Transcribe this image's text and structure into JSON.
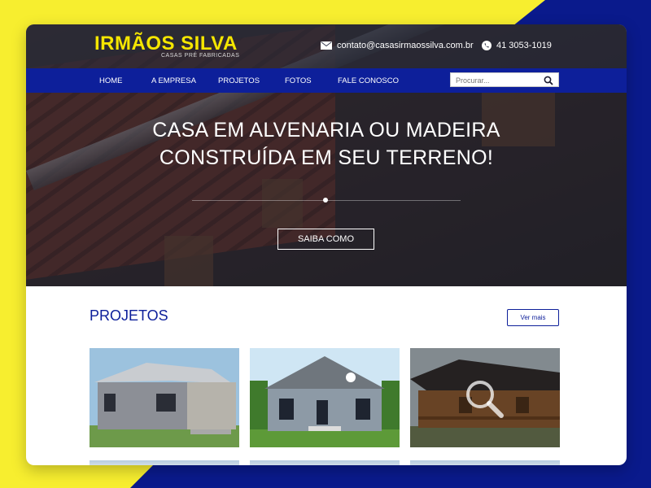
{
  "brand": {
    "title": "IRMÃOS SILVA",
    "subtitle": "CASAS PRÉ FABRICADAS",
    "accent_color": "#f5e600",
    "nav_color": "#0d1f9a"
  },
  "contact": {
    "email": "contato@casasirmaossilva.com.br",
    "email_icon": "envelope-icon",
    "phone": "41 3053-1019",
    "phone_icon": "phone-icon"
  },
  "nav": {
    "items": [
      {
        "label": "HOME"
      },
      {
        "label": "A EMPRESA"
      },
      {
        "label": "PROJETOS"
      },
      {
        "label": "FOTOS"
      },
      {
        "label": "FALE CONOSCO"
      }
    ]
  },
  "search": {
    "placeholder": "Procurar...",
    "icon": "search-icon"
  },
  "hero": {
    "headline_line1": "CASA EM ALVENARIA OU MADEIRA",
    "headline_line2": "CONSTRUÍDA EM SEU TERRENO!",
    "cta_label": "SAIBA COMO"
  },
  "projects": {
    "title": "PROJETOS",
    "more_label": "Ver mais",
    "hover_icon": "zoom-icon"
  }
}
